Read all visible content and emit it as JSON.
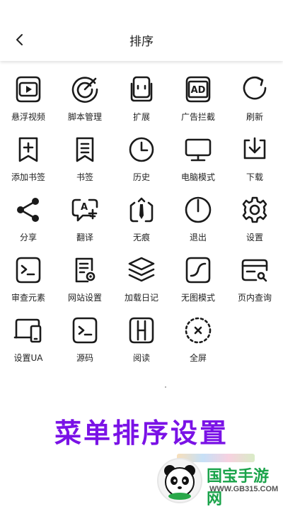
{
  "header": {
    "title": "排序",
    "back_icon": "chevron-left-icon"
  },
  "menu_items": [
    {
      "label": "悬浮视频",
      "icon": "floating-video-icon"
    },
    {
      "label": "脚本管理",
      "icon": "script-icon"
    },
    {
      "label": "扩展",
      "icon": "extension-icon"
    },
    {
      "label": "广告拦截",
      "icon": "ad-block-icon"
    },
    {
      "label": "刷新",
      "icon": "refresh-icon"
    },
    {
      "label": "添加书签",
      "icon": "add-bookmark-icon"
    },
    {
      "label": "书签",
      "icon": "bookmark-icon"
    },
    {
      "label": "历史",
      "icon": "history-icon"
    },
    {
      "label": "电脑模式",
      "icon": "desktop-icon"
    },
    {
      "label": "下载",
      "icon": "download-icon"
    },
    {
      "label": "分享",
      "icon": "share-icon"
    },
    {
      "label": "翻译",
      "icon": "translate-icon"
    },
    {
      "label": "无痕",
      "icon": "incognito-icon"
    },
    {
      "label": "退出",
      "icon": "power-icon"
    },
    {
      "label": "设置",
      "icon": "gear-icon"
    },
    {
      "label": "审查元素",
      "icon": "inspect-icon"
    },
    {
      "label": "网站设置",
      "icon": "site-settings-icon"
    },
    {
      "label": "加载日记",
      "icon": "layers-icon"
    },
    {
      "label": "无图模式",
      "icon": "no-image-icon"
    },
    {
      "label": "页内查询",
      "icon": "find-in-page-icon"
    },
    {
      "label": "设置UA",
      "icon": "user-agent-icon"
    },
    {
      "label": "源码",
      "icon": "source-code-icon"
    },
    {
      "label": "阅读",
      "icon": "reader-icon"
    },
    {
      "label": "全屏",
      "icon": "fullscreen-icon"
    }
  ],
  "banner": {
    "text": "菜单排序设置",
    "color": "#7a12e6"
  },
  "watermark": {
    "brand": "国宝手游网",
    "url": "WWW.GB315.COM"
  }
}
